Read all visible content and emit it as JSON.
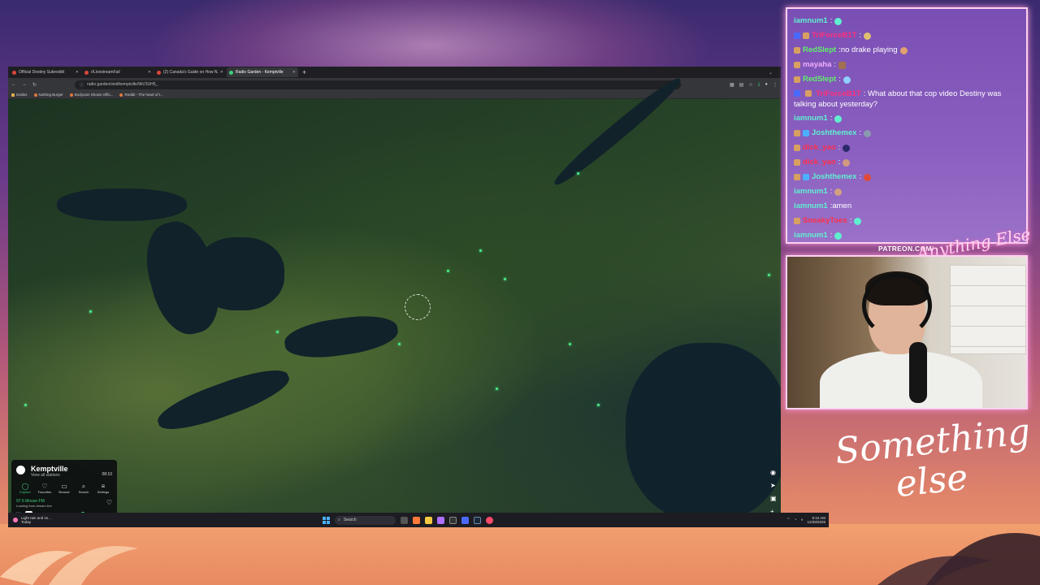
{
  "browser": {
    "tabs": [
      {
        "title": "Official Destiny Subreddit",
        "active": false
      },
      {
        "title": "r/LivestreamFail",
        "active": false
      },
      {
        "title": "(2) Canada's Guide on How N...",
        "active": false
      },
      {
        "title": "Radio Garden - Kemptville",
        "active": true
      }
    ],
    "url": "radio.garden/visit/kemptville/9kV3UH5_",
    "bookmarks": [
      "Dailies",
      "Nothing Burger",
      "Bodycam Shows Offic...",
      "Reddit - The heart of t..."
    ]
  },
  "radio_garden": {
    "city": "Kemptville",
    "subtitle": "View all stations",
    "time": "08:10",
    "nav": [
      {
        "label": "Explore",
        "icon": "explore-icon"
      },
      {
        "label": "Favorites",
        "icon": "heart-icon"
      },
      {
        "label": "Browse",
        "icon": "map-icon"
      },
      {
        "label": "Search",
        "icon": "search-icon"
      },
      {
        "label": "Settings",
        "icon": "menu-icon"
      }
    ],
    "station": "97.5 Moose FM",
    "status": "Loading from stream.live"
  },
  "taskbar": {
    "weather": "Light rain and sn...",
    "weather_sub": "Today",
    "search_placeholder": "Search",
    "time": "8:10 AM",
    "date": "12/28/2025"
  },
  "chat": {
    "messages": [
      {
        "user": "iamnum1",
        "color": "#5ff0d0",
        "text": ""
      },
      {
        "user": "TriForceB1T",
        "color": "#ff2f7a",
        "text": ""
      },
      {
        "user": "RedSlept",
        "color": "#5ff06a",
        "text": "no drake playing"
      },
      {
        "user": "mayaha",
        "color": "#f0b0ff",
        "text": ""
      },
      {
        "user": "RedSlept",
        "color": "#5ff06a",
        "text": ""
      },
      {
        "user": "TriForceB1T",
        "color": "#ff2f7a",
        "text": "What about that cop video Destiny was talking about yesterday?"
      },
      {
        "user": "iamnum1",
        "color": "#5ff0d0",
        "text": ""
      },
      {
        "user": "Joshthemex",
        "color": "#5ff0d0",
        "text": ""
      },
      {
        "user": "dick_yao",
        "color": "#ff2f4a",
        "text": ""
      },
      {
        "user": "dick_yao",
        "color": "#ff2f4a",
        "text": ""
      },
      {
        "user": "Joshthemex",
        "color": "#5ff0d0",
        "text": ""
      },
      {
        "user": "iamnum1",
        "color": "#5ff0d0",
        "text": ""
      },
      {
        "user": "iamnum1",
        "color": "#5ff0d0",
        "text": "amen"
      },
      {
        "user": "SneakyToes",
        "color": "#ff2f4a",
        "text": ""
      },
      {
        "user": "iamnum1",
        "color": "#5ff0d0",
        "text": ""
      }
    ]
  },
  "overlay": {
    "patreon": "PATREON.COM/",
    "anything_else": "Anything Else",
    "something_line1": "Something",
    "something_line2": "else"
  }
}
